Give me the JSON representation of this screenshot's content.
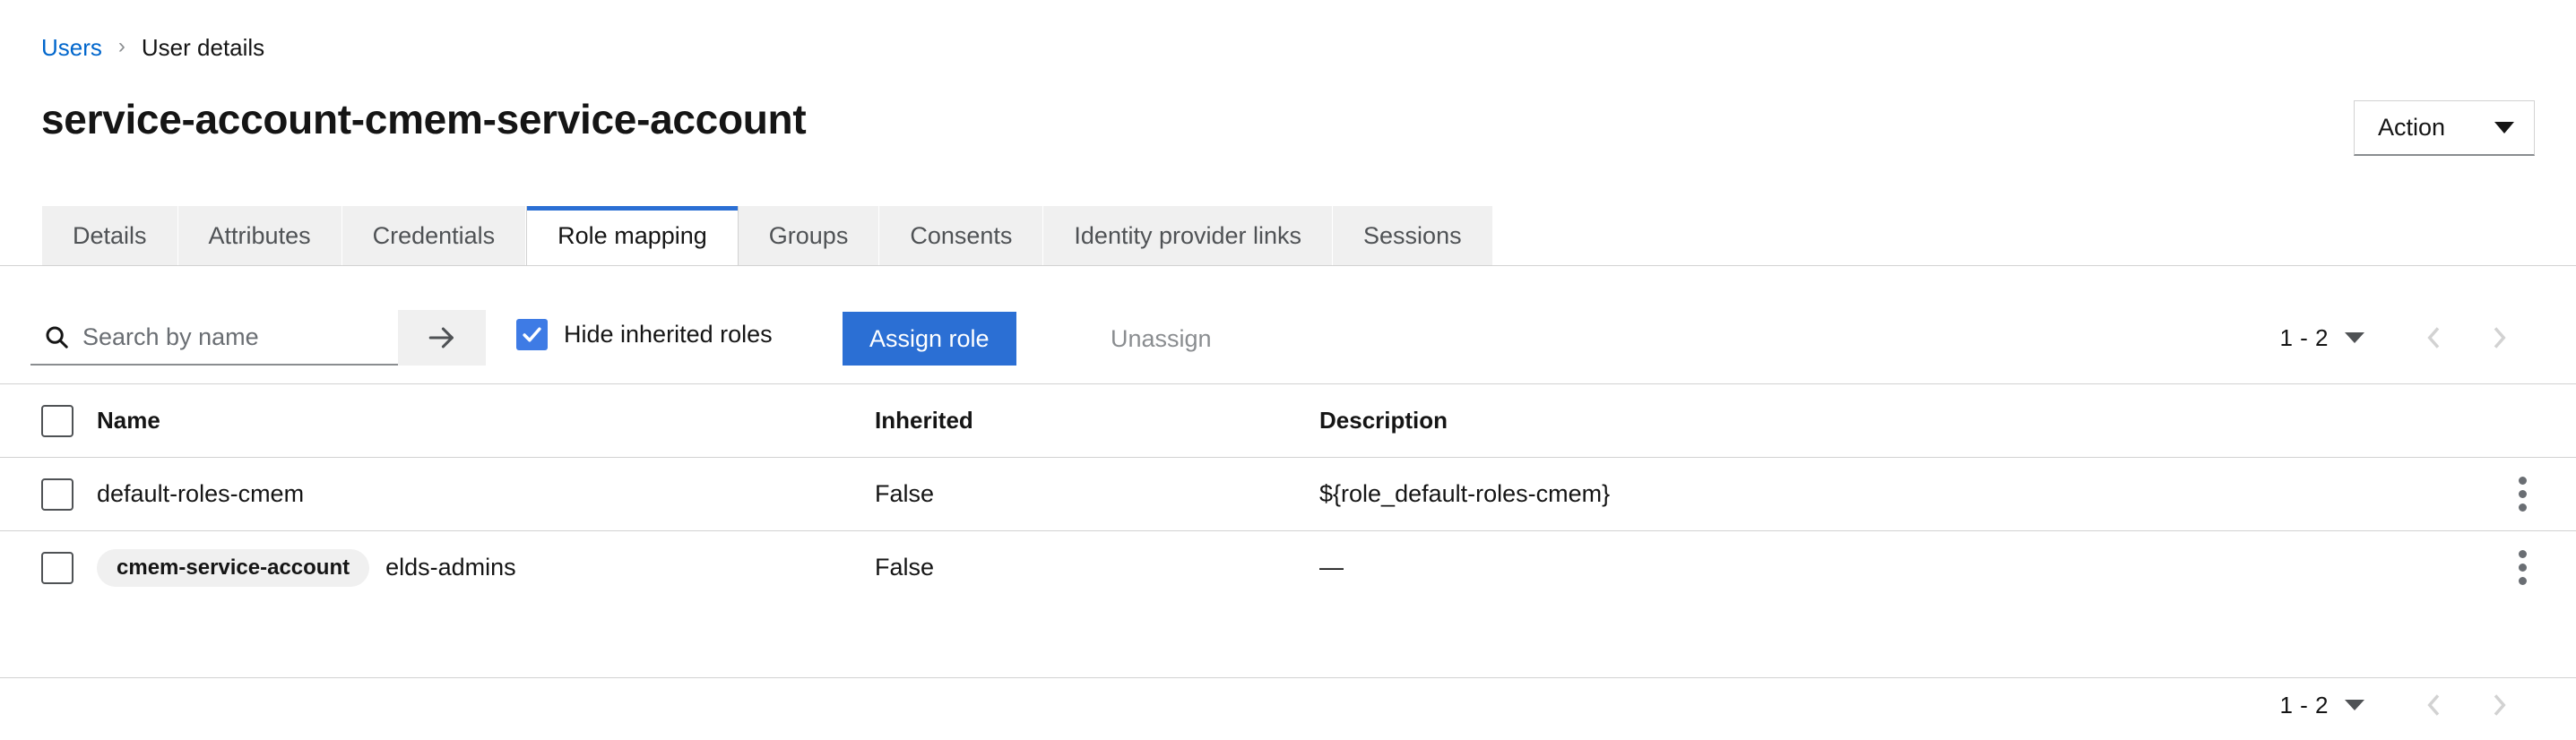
{
  "breadcrumb": {
    "parent": "Users",
    "separator": "›",
    "current": "User details"
  },
  "header": {
    "title": "service-account-cmem-service-account",
    "action_label": "Action"
  },
  "tabs": [
    {
      "label": "Details",
      "active": false
    },
    {
      "label": "Attributes",
      "active": false
    },
    {
      "label": "Credentials",
      "active": false
    },
    {
      "label": "Role mapping",
      "active": true
    },
    {
      "label": "Groups",
      "active": false
    },
    {
      "label": "Consents",
      "active": false
    },
    {
      "label": "Identity provider links",
      "active": false
    },
    {
      "label": "Sessions",
      "active": false
    }
  ],
  "toolbar": {
    "search_placeholder": "Search by name",
    "search_value": "",
    "hide_inherited_label": "Hide inherited roles",
    "hide_inherited_checked": true,
    "assign_label": "Assign role",
    "unassign_label": "Unassign"
  },
  "pagination": {
    "range": "1 - 2",
    "prev_label": "Go to previous page",
    "next_label": "Go to next page"
  },
  "table": {
    "columns": {
      "name": "Name",
      "inherited": "Inherited",
      "description": "Description"
    },
    "rows": [
      {
        "badge": "",
        "name": "default-roles-cmem",
        "inherited": "False",
        "description": "${role_default-roles-cmem}"
      },
      {
        "badge": "cmem-service-account",
        "name": "elds-admins",
        "inherited": "False",
        "description": "—"
      }
    ]
  },
  "colors": {
    "accent": "#2b6fd4",
    "link": "#0066cc",
    "checkbox": "#3e7be5",
    "tab_bg": "#f0f0f0",
    "border": "#d2d2d2",
    "muted_text": "#8a8d90"
  }
}
